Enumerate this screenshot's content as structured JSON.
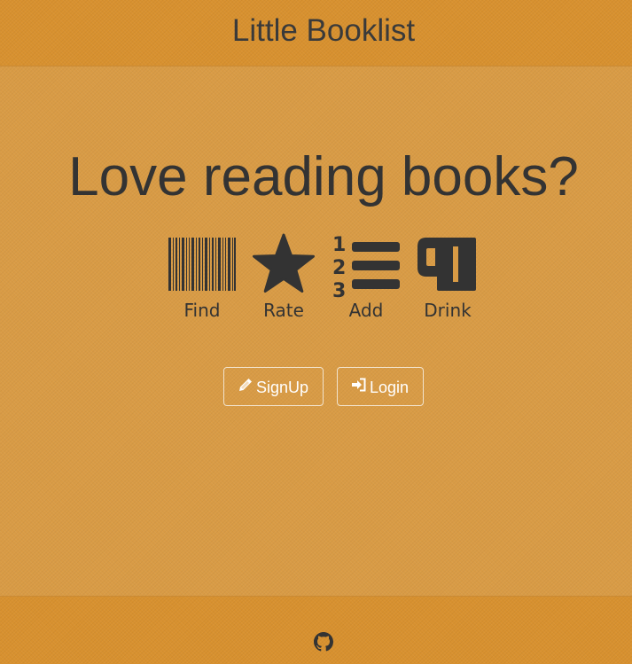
{
  "app": {
    "title": "Little Booklist"
  },
  "hero": {
    "headline": "Love reading books?"
  },
  "features": [
    {
      "icon": "barcode-icon",
      "label": "Find"
    },
    {
      "icon": "star-icon",
      "label": "Rate"
    },
    {
      "icon": "ordered-list-icon",
      "label": "Add"
    },
    {
      "icon": "mug-icon",
      "label": "Drink"
    }
  ],
  "actions": {
    "signup_label": "SignUp",
    "signup_icon": "pencil-icon",
    "login_label": "Login",
    "login_icon": "sign-in-icon"
  },
  "footer": {
    "github_icon": "github-icon"
  },
  "colors": {
    "background": "#d99b45",
    "bar": "#d8912f",
    "text": "#333333",
    "button_text": "#ffffff"
  }
}
